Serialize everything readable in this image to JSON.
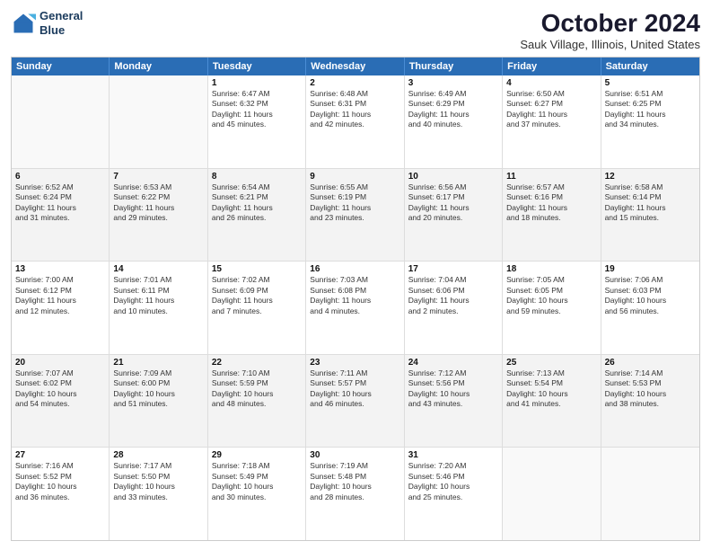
{
  "logo": {
    "line1": "General",
    "line2": "Blue"
  },
  "title": "October 2024",
  "subtitle": "Sauk Village, Illinois, United States",
  "header_days": [
    "Sunday",
    "Monday",
    "Tuesday",
    "Wednesday",
    "Thursday",
    "Friday",
    "Saturday"
  ],
  "weeks": [
    [
      {
        "day": "",
        "lines": [],
        "empty": true
      },
      {
        "day": "",
        "lines": [],
        "empty": true
      },
      {
        "day": "1",
        "lines": [
          "Sunrise: 6:47 AM",
          "Sunset: 6:32 PM",
          "Daylight: 11 hours",
          "and 45 minutes."
        ]
      },
      {
        "day": "2",
        "lines": [
          "Sunrise: 6:48 AM",
          "Sunset: 6:31 PM",
          "Daylight: 11 hours",
          "and 42 minutes."
        ]
      },
      {
        "day": "3",
        "lines": [
          "Sunrise: 6:49 AM",
          "Sunset: 6:29 PM",
          "Daylight: 11 hours",
          "and 40 minutes."
        ]
      },
      {
        "day": "4",
        "lines": [
          "Sunrise: 6:50 AM",
          "Sunset: 6:27 PM",
          "Daylight: 11 hours",
          "and 37 minutes."
        ]
      },
      {
        "day": "5",
        "lines": [
          "Sunrise: 6:51 AM",
          "Sunset: 6:25 PM",
          "Daylight: 11 hours",
          "and 34 minutes."
        ]
      }
    ],
    [
      {
        "day": "6",
        "lines": [
          "Sunrise: 6:52 AM",
          "Sunset: 6:24 PM",
          "Daylight: 11 hours",
          "and 31 minutes."
        ]
      },
      {
        "day": "7",
        "lines": [
          "Sunrise: 6:53 AM",
          "Sunset: 6:22 PM",
          "Daylight: 11 hours",
          "and 29 minutes."
        ]
      },
      {
        "day": "8",
        "lines": [
          "Sunrise: 6:54 AM",
          "Sunset: 6:21 PM",
          "Daylight: 11 hours",
          "and 26 minutes."
        ]
      },
      {
        "day": "9",
        "lines": [
          "Sunrise: 6:55 AM",
          "Sunset: 6:19 PM",
          "Daylight: 11 hours",
          "and 23 minutes."
        ]
      },
      {
        "day": "10",
        "lines": [
          "Sunrise: 6:56 AM",
          "Sunset: 6:17 PM",
          "Daylight: 11 hours",
          "and 20 minutes."
        ]
      },
      {
        "day": "11",
        "lines": [
          "Sunrise: 6:57 AM",
          "Sunset: 6:16 PM",
          "Daylight: 11 hours",
          "and 18 minutes."
        ]
      },
      {
        "day": "12",
        "lines": [
          "Sunrise: 6:58 AM",
          "Sunset: 6:14 PM",
          "Daylight: 11 hours",
          "and 15 minutes."
        ]
      }
    ],
    [
      {
        "day": "13",
        "lines": [
          "Sunrise: 7:00 AM",
          "Sunset: 6:12 PM",
          "Daylight: 11 hours",
          "and 12 minutes."
        ]
      },
      {
        "day": "14",
        "lines": [
          "Sunrise: 7:01 AM",
          "Sunset: 6:11 PM",
          "Daylight: 11 hours",
          "and 10 minutes."
        ]
      },
      {
        "day": "15",
        "lines": [
          "Sunrise: 7:02 AM",
          "Sunset: 6:09 PM",
          "Daylight: 11 hours",
          "and 7 minutes."
        ]
      },
      {
        "day": "16",
        "lines": [
          "Sunrise: 7:03 AM",
          "Sunset: 6:08 PM",
          "Daylight: 11 hours",
          "and 4 minutes."
        ]
      },
      {
        "day": "17",
        "lines": [
          "Sunrise: 7:04 AM",
          "Sunset: 6:06 PM",
          "Daylight: 11 hours",
          "and 2 minutes."
        ]
      },
      {
        "day": "18",
        "lines": [
          "Sunrise: 7:05 AM",
          "Sunset: 6:05 PM",
          "Daylight: 10 hours",
          "and 59 minutes."
        ]
      },
      {
        "day": "19",
        "lines": [
          "Sunrise: 7:06 AM",
          "Sunset: 6:03 PM",
          "Daylight: 10 hours",
          "and 56 minutes."
        ]
      }
    ],
    [
      {
        "day": "20",
        "lines": [
          "Sunrise: 7:07 AM",
          "Sunset: 6:02 PM",
          "Daylight: 10 hours",
          "and 54 minutes."
        ]
      },
      {
        "day": "21",
        "lines": [
          "Sunrise: 7:09 AM",
          "Sunset: 6:00 PM",
          "Daylight: 10 hours",
          "and 51 minutes."
        ]
      },
      {
        "day": "22",
        "lines": [
          "Sunrise: 7:10 AM",
          "Sunset: 5:59 PM",
          "Daylight: 10 hours",
          "and 48 minutes."
        ]
      },
      {
        "day": "23",
        "lines": [
          "Sunrise: 7:11 AM",
          "Sunset: 5:57 PM",
          "Daylight: 10 hours",
          "and 46 minutes."
        ]
      },
      {
        "day": "24",
        "lines": [
          "Sunrise: 7:12 AM",
          "Sunset: 5:56 PM",
          "Daylight: 10 hours",
          "and 43 minutes."
        ]
      },
      {
        "day": "25",
        "lines": [
          "Sunrise: 7:13 AM",
          "Sunset: 5:54 PM",
          "Daylight: 10 hours",
          "and 41 minutes."
        ]
      },
      {
        "day": "26",
        "lines": [
          "Sunrise: 7:14 AM",
          "Sunset: 5:53 PM",
          "Daylight: 10 hours",
          "and 38 minutes."
        ]
      }
    ],
    [
      {
        "day": "27",
        "lines": [
          "Sunrise: 7:16 AM",
          "Sunset: 5:52 PM",
          "Daylight: 10 hours",
          "and 36 minutes."
        ]
      },
      {
        "day": "28",
        "lines": [
          "Sunrise: 7:17 AM",
          "Sunset: 5:50 PM",
          "Daylight: 10 hours",
          "and 33 minutes."
        ]
      },
      {
        "day": "29",
        "lines": [
          "Sunrise: 7:18 AM",
          "Sunset: 5:49 PM",
          "Daylight: 10 hours",
          "and 30 minutes."
        ]
      },
      {
        "day": "30",
        "lines": [
          "Sunrise: 7:19 AM",
          "Sunset: 5:48 PM",
          "Daylight: 10 hours",
          "and 28 minutes."
        ]
      },
      {
        "day": "31",
        "lines": [
          "Sunrise: 7:20 AM",
          "Sunset: 5:46 PM",
          "Daylight: 10 hours",
          "and 25 minutes."
        ]
      },
      {
        "day": "",
        "lines": [],
        "empty": true
      },
      {
        "day": "",
        "lines": [],
        "empty": true
      }
    ]
  ]
}
